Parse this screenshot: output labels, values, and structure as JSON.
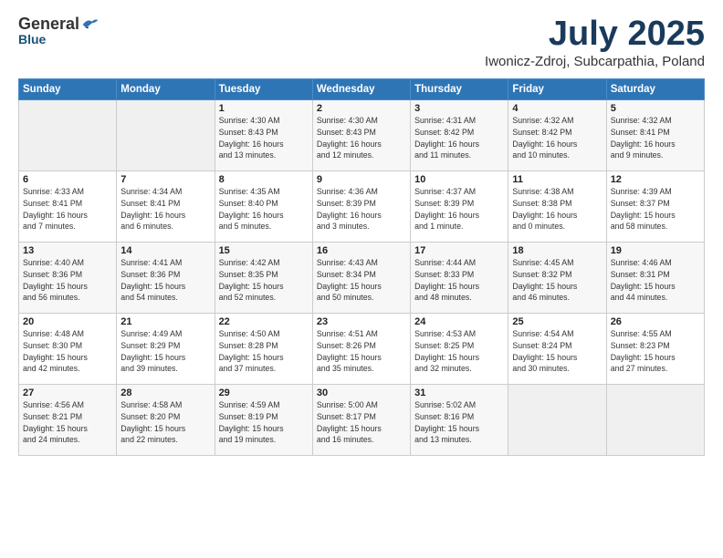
{
  "header": {
    "logo": {
      "general": "General",
      "blue": "Blue"
    },
    "title": "July 2025",
    "location": "Iwonicz-Zdroj, Subcarpathia, Poland"
  },
  "weekdays": [
    "Sunday",
    "Monday",
    "Tuesday",
    "Wednesday",
    "Thursday",
    "Friday",
    "Saturday"
  ],
  "weeks": [
    [
      {
        "day": "",
        "details": []
      },
      {
        "day": "",
        "details": []
      },
      {
        "day": "1",
        "details": [
          "Sunrise: 4:30 AM",
          "Sunset: 8:43 PM",
          "Daylight: 16 hours",
          "and 13 minutes."
        ]
      },
      {
        "day": "2",
        "details": [
          "Sunrise: 4:30 AM",
          "Sunset: 8:43 PM",
          "Daylight: 16 hours",
          "and 12 minutes."
        ]
      },
      {
        "day": "3",
        "details": [
          "Sunrise: 4:31 AM",
          "Sunset: 8:42 PM",
          "Daylight: 16 hours",
          "and 11 minutes."
        ]
      },
      {
        "day": "4",
        "details": [
          "Sunrise: 4:32 AM",
          "Sunset: 8:42 PM",
          "Daylight: 16 hours",
          "and 10 minutes."
        ]
      },
      {
        "day": "5",
        "details": [
          "Sunrise: 4:32 AM",
          "Sunset: 8:41 PM",
          "Daylight: 16 hours",
          "and 9 minutes."
        ]
      }
    ],
    [
      {
        "day": "6",
        "details": [
          "Sunrise: 4:33 AM",
          "Sunset: 8:41 PM",
          "Daylight: 16 hours",
          "and 7 minutes."
        ]
      },
      {
        "day": "7",
        "details": [
          "Sunrise: 4:34 AM",
          "Sunset: 8:41 PM",
          "Daylight: 16 hours",
          "and 6 minutes."
        ]
      },
      {
        "day": "8",
        "details": [
          "Sunrise: 4:35 AM",
          "Sunset: 8:40 PM",
          "Daylight: 16 hours",
          "and 5 minutes."
        ]
      },
      {
        "day": "9",
        "details": [
          "Sunrise: 4:36 AM",
          "Sunset: 8:39 PM",
          "Daylight: 16 hours",
          "and 3 minutes."
        ]
      },
      {
        "day": "10",
        "details": [
          "Sunrise: 4:37 AM",
          "Sunset: 8:39 PM",
          "Daylight: 16 hours",
          "and 1 minute."
        ]
      },
      {
        "day": "11",
        "details": [
          "Sunrise: 4:38 AM",
          "Sunset: 8:38 PM",
          "Daylight: 16 hours",
          "and 0 minutes."
        ]
      },
      {
        "day": "12",
        "details": [
          "Sunrise: 4:39 AM",
          "Sunset: 8:37 PM",
          "Daylight: 15 hours",
          "and 58 minutes."
        ]
      }
    ],
    [
      {
        "day": "13",
        "details": [
          "Sunrise: 4:40 AM",
          "Sunset: 8:36 PM",
          "Daylight: 15 hours",
          "and 56 minutes."
        ]
      },
      {
        "day": "14",
        "details": [
          "Sunrise: 4:41 AM",
          "Sunset: 8:36 PM",
          "Daylight: 15 hours",
          "and 54 minutes."
        ]
      },
      {
        "day": "15",
        "details": [
          "Sunrise: 4:42 AM",
          "Sunset: 8:35 PM",
          "Daylight: 15 hours",
          "and 52 minutes."
        ]
      },
      {
        "day": "16",
        "details": [
          "Sunrise: 4:43 AM",
          "Sunset: 8:34 PM",
          "Daylight: 15 hours",
          "and 50 minutes."
        ]
      },
      {
        "day": "17",
        "details": [
          "Sunrise: 4:44 AM",
          "Sunset: 8:33 PM",
          "Daylight: 15 hours",
          "and 48 minutes."
        ]
      },
      {
        "day": "18",
        "details": [
          "Sunrise: 4:45 AM",
          "Sunset: 8:32 PM",
          "Daylight: 15 hours",
          "and 46 minutes."
        ]
      },
      {
        "day": "19",
        "details": [
          "Sunrise: 4:46 AM",
          "Sunset: 8:31 PM",
          "Daylight: 15 hours",
          "and 44 minutes."
        ]
      }
    ],
    [
      {
        "day": "20",
        "details": [
          "Sunrise: 4:48 AM",
          "Sunset: 8:30 PM",
          "Daylight: 15 hours",
          "and 42 minutes."
        ]
      },
      {
        "day": "21",
        "details": [
          "Sunrise: 4:49 AM",
          "Sunset: 8:29 PM",
          "Daylight: 15 hours",
          "and 39 minutes."
        ]
      },
      {
        "day": "22",
        "details": [
          "Sunrise: 4:50 AM",
          "Sunset: 8:28 PM",
          "Daylight: 15 hours",
          "and 37 minutes."
        ]
      },
      {
        "day": "23",
        "details": [
          "Sunrise: 4:51 AM",
          "Sunset: 8:26 PM",
          "Daylight: 15 hours",
          "and 35 minutes."
        ]
      },
      {
        "day": "24",
        "details": [
          "Sunrise: 4:53 AM",
          "Sunset: 8:25 PM",
          "Daylight: 15 hours",
          "and 32 minutes."
        ]
      },
      {
        "day": "25",
        "details": [
          "Sunrise: 4:54 AM",
          "Sunset: 8:24 PM",
          "Daylight: 15 hours",
          "and 30 minutes."
        ]
      },
      {
        "day": "26",
        "details": [
          "Sunrise: 4:55 AM",
          "Sunset: 8:23 PM",
          "Daylight: 15 hours",
          "and 27 minutes."
        ]
      }
    ],
    [
      {
        "day": "27",
        "details": [
          "Sunrise: 4:56 AM",
          "Sunset: 8:21 PM",
          "Daylight: 15 hours",
          "and 24 minutes."
        ]
      },
      {
        "day": "28",
        "details": [
          "Sunrise: 4:58 AM",
          "Sunset: 8:20 PM",
          "Daylight: 15 hours",
          "and 22 minutes."
        ]
      },
      {
        "day": "29",
        "details": [
          "Sunrise: 4:59 AM",
          "Sunset: 8:19 PM",
          "Daylight: 15 hours",
          "and 19 minutes."
        ]
      },
      {
        "day": "30",
        "details": [
          "Sunrise: 5:00 AM",
          "Sunset: 8:17 PM",
          "Daylight: 15 hours",
          "and 16 minutes."
        ]
      },
      {
        "day": "31",
        "details": [
          "Sunrise: 5:02 AM",
          "Sunset: 8:16 PM",
          "Daylight: 15 hours",
          "and 13 minutes."
        ]
      },
      {
        "day": "",
        "details": []
      },
      {
        "day": "",
        "details": []
      }
    ]
  ]
}
